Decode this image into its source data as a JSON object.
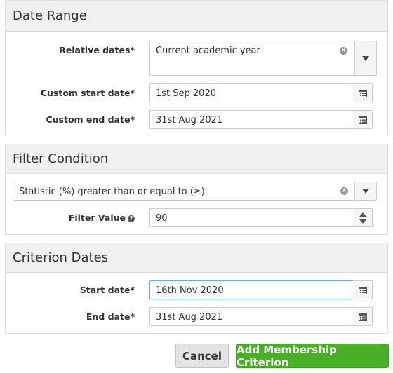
{
  "date_range": {
    "title": "Date Range",
    "relative_label": "Relative dates*",
    "relative_value": "Current academic year",
    "start_label": "Custom start date*",
    "start_value": "1st Sep 2020",
    "end_label": "Custom end date*",
    "end_value": "31st Aug 2021"
  },
  "filter_condition": {
    "title": "Filter Condition",
    "condition_value": "Statistic (%) greater than or equal to (≥)",
    "filter_value_label": "Filter Value",
    "filter_value": "90"
  },
  "criterion_dates": {
    "title": "Criterion Dates",
    "start_label": "Start date*",
    "start_value": "16th Nov 2020",
    "end_label": "End date*",
    "end_value": "31st Aug 2021"
  },
  "buttons": {
    "cancel": "Cancel",
    "add": "Add Membership Criterion"
  },
  "colors": {
    "accent_green": "#47b026",
    "focus_blue": "#66afe9",
    "header_bg": "#f0f0f0"
  },
  "icons": {
    "calendar": "calendar-icon",
    "clear": "clear-icon",
    "dropdown": "chevron-down-icon",
    "help": "help-icon"
  }
}
